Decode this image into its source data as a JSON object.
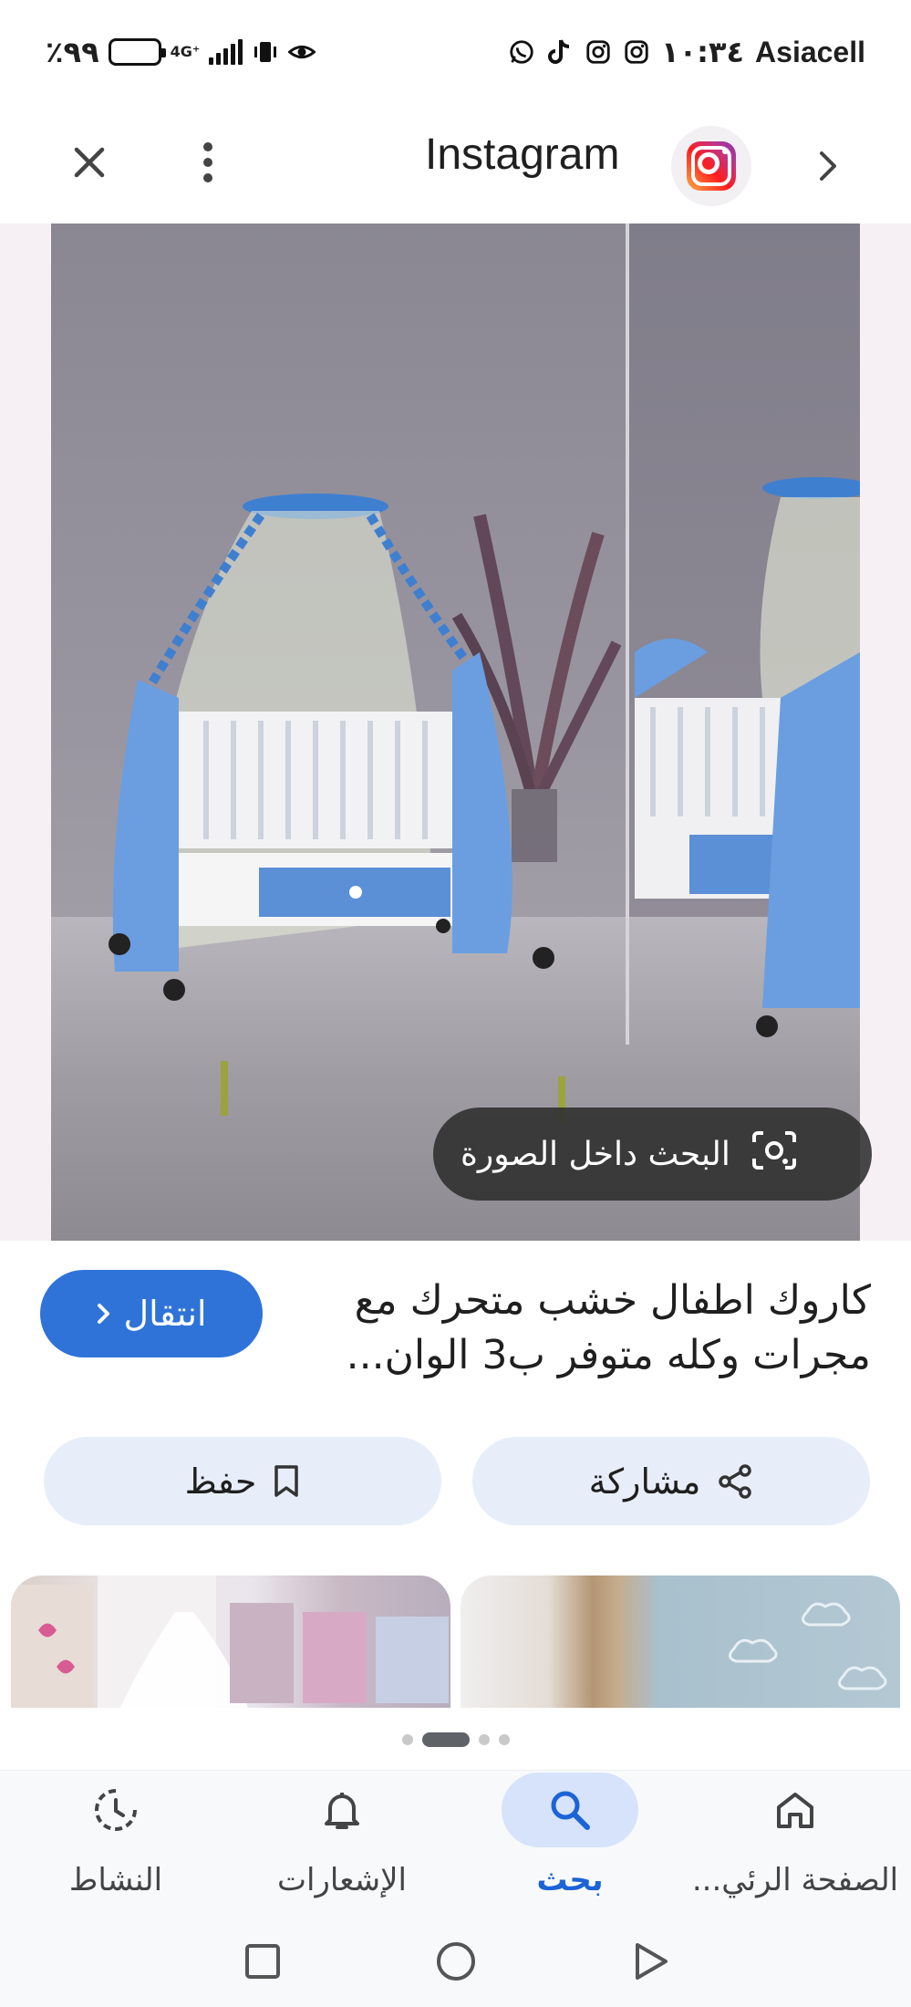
{
  "status_bar": {
    "battery_text": "٪٩٩",
    "network_type": "4G⁺",
    "time": "١٠:٣٤",
    "carrier": "Asiacell",
    "icons": [
      "whatsapp-icon",
      "tiktok-icon",
      "instagram-icon",
      "instagram-icon",
      "eye-icon",
      "vibrate-icon",
      "signal-icon",
      "battery-icon"
    ]
  },
  "app_bar": {
    "source_title": "Instagram",
    "icons": {
      "close": "close-icon",
      "more": "more-vert-icon",
      "source": "instagram-logo-icon",
      "forward": "chevron-right-icon"
    }
  },
  "image": {
    "search_in_image_label": "البحث داخل الصورة"
  },
  "details": {
    "title": "كاروك اطفال خشب متحرك مع مجرات وكله متوفر ب3 الوان...",
    "visit_label": "انتقال"
  },
  "actions": {
    "share_label": "مشاركة",
    "save_label": "حفظ"
  },
  "pager": {
    "count": 4,
    "active_index": 1
  },
  "bottom_nav": {
    "items": [
      {
        "label": "الصفحة الرئي...",
        "icon": "home-icon",
        "active": false
      },
      {
        "label": "بحث",
        "icon": "search-icon",
        "active": true
      },
      {
        "label": "الإشعارات",
        "icon": "bell-icon",
        "active": false
      },
      {
        "label": "النشاط",
        "icon": "activity-icon",
        "active": false
      }
    ]
  },
  "colors": {
    "accent": "#2f73d9",
    "active_nav": "#1b63d6",
    "chip_bg": "#e8eef9"
  }
}
